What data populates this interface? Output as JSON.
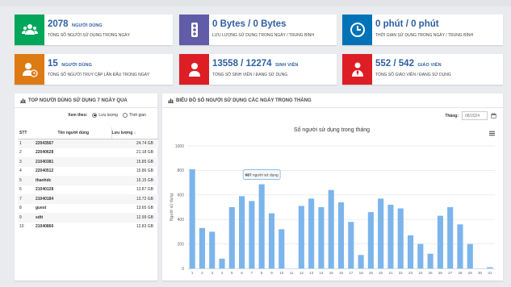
{
  "colors": {
    "green": "#00a65a",
    "purple": "#605ca8",
    "blue": "#0073b7",
    "orange": "#dd7a13",
    "red": "#dd1e25",
    "accent": "#2f5fa3",
    "bar": "#7cb5ec"
  },
  "stats": [
    {
      "icon": "users-icon",
      "color": "#00a65a",
      "value": "2078",
      "unit": "người dùng",
      "label": "Tổng số người sử dụng trong ngày"
    },
    {
      "icon": "traffic-icon",
      "color": "#605ca8",
      "value": "0 Bytes / 0 Bytes",
      "unit": "",
      "label": "Lưu lượng sử dụng trong ngày / trung bình"
    },
    {
      "icon": "clock-icon",
      "color": "#0073b7",
      "value": "0 phút / 0 phút",
      "unit": "",
      "label": "Thời gian sử dụng trong ngày / trung bình"
    },
    {
      "icon": "user-clock-icon",
      "color": "#dd7a13",
      "value": "15",
      "unit": "người dùng",
      "label": "Tổng số người truy cập lần đầu trong ngày"
    },
    {
      "icon": "student-icon",
      "color": "#dd1e25",
      "value": "13558 / 12274",
      "unit": "sinh viên",
      "label": "Tổng số sinh viên / đang sử dụng"
    },
    {
      "icon": "teacher-icon",
      "color": "#dd1e25",
      "value": "552 / 542",
      "unit": "giáo viên",
      "label": "Tổng số giáo viên / đang sử dụng"
    }
  ],
  "top_users": {
    "title": "Top người dùng sử dụng 7 ngày qua",
    "filter_label": "Xem theo:",
    "option_traffic": "Lưu lượng",
    "option_time": "Thời gian",
    "headers": {
      "stt": "STT",
      "name": "Tên người dùng",
      "value": "Lưu lượng"
    },
    "rows": [
      {
        "stt": "1",
        "name": "22043567",
        "value": "24.74 GB"
      },
      {
        "stt": "2",
        "name": "22040628",
        "value": "21.18 GB"
      },
      {
        "stt": "3",
        "name": "21040381",
        "value": "15.85 GB"
      },
      {
        "stt": "4",
        "name": "22040512",
        "value": "15.86 GB"
      },
      {
        "stt": "5",
        "name": "thanhdc",
        "value": "15.15 GB"
      },
      {
        "stt": "6",
        "name": "21040128",
        "value": "13.87 GB"
      },
      {
        "stt": "7",
        "name": "21040184",
        "value": "13.72 GB"
      },
      {
        "stt": "8",
        "name": "guest",
        "value": "13.65 GB"
      },
      {
        "stt": "9",
        "name": "sdtt",
        "value": "12.99 GB"
      },
      {
        "stt": "10",
        "name": "21040866",
        "value": "12.83 GB"
      }
    ]
  },
  "monthly": {
    "title": "Biểu đồ số người sử dụng các ngày trong tháng",
    "month_label": "Tháng:",
    "month_value": "08/2024"
  },
  "chart_data": {
    "type": "bar",
    "title": "Số người sử dụng trong tháng",
    "ylabel": "Người sử dụng",
    "xlabel": "",
    "ylim": [
      0,
      1000
    ],
    "yticks": [
      0,
      200,
      400,
      600,
      800,
      1000
    ],
    "categories": [
      "1",
      "2",
      "3",
      "4",
      "5",
      "6",
      "7",
      "8",
      "9",
      "10",
      "11",
      "12",
      "13",
      "14",
      "15",
      "16",
      "17",
      "18",
      "19",
      "20",
      "21",
      "22",
      "23",
      "24",
      "25",
      "26",
      "27",
      "28",
      "29",
      "30",
      "31"
    ],
    "values": [
      810,
      330,
      300,
      80,
      500,
      590,
      550,
      687,
      450,
      320,
      0,
      510,
      570,
      500,
      640,
      540,
      380,
      110,
      460,
      570,
      520,
      490,
      270,
      200,
      120,
      430,
      500,
      360,
      200,
      0,
      10
    ],
    "tooltip": {
      "index": 7,
      "value": "687",
      "text": "người sử dụng"
    }
  }
}
